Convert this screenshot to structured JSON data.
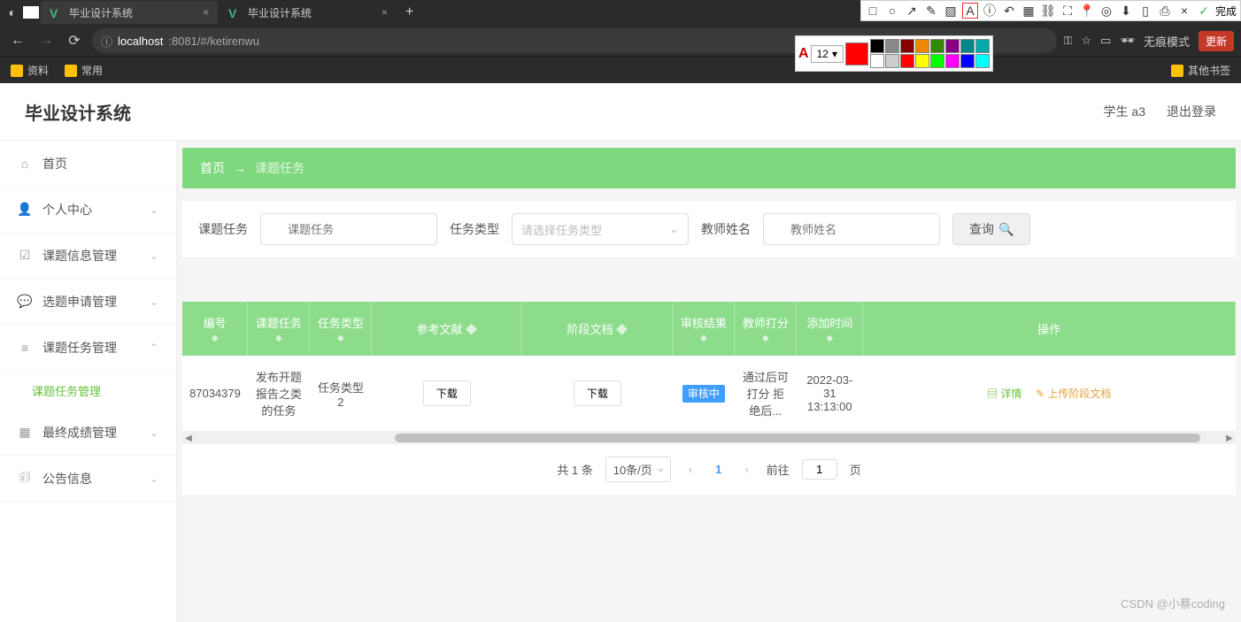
{
  "browser": {
    "tabs": [
      {
        "title": "毕业设计系统",
        "active": true
      },
      {
        "title": "毕业设计系统",
        "active": false
      }
    ],
    "url_host": "localhost",
    "url_path": ":8081/#/ketirenwu",
    "bookmarks": [
      "资料",
      "常用"
    ],
    "bookmark_right": "其他书签",
    "incognito": "无痕模式",
    "update": "更新",
    "done": "完成"
  },
  "annot": {
    "font_size": "12",
    "letter": "A"
  },
  "header": {
    "title": "毕业设计系统",
    "user": "学生 a3",
    "logout": "退出登录"
  },
  "sidebar": {
    "items": [
      {
        "label": "首页",
        "icon": "⌂",
        "expandable": false
      },
      {
        "label": "个人中心",
        "icon": "👤",
        "expandable": true
      },
      {
        "label": "课题信息管理",
        "icon": "☑",
        "expandable": true
      },
      {
        "label": "选题申请管理",
        "icon": "💬",
        "expandable": true
      },
      {
        "label": "课题任务管理",
        "icon": "≡",
        "expandable": true,
        "open": true
      },
      {
        "label": "最终成绩管理",
        "icon": "▦",
        "expandable": true
      },
      {
        "label": "公告信息",
        "icon": "🗊",
        "expandable": true
      }
    ],
    "submenu_active": "课题任务管理"
  },
  "breadcrumb": {
    "home": "首页",
    "arrow": "→",
    "current": "课题任务"
  },
  "search": {
    "label1": "课题任务",
    "ph1": "课题任务",
    "label2": "任务类型",
    "ph2": "请选择任务类型",
    "label3": "教师姓名",
    "ph3": "教师姓名",
    "query": "查询"
  },
  "table": {
    "headers": [
      "编号",
      "课题任务",
      "任务类型",
      "参考文献",
      "阶段文档",
      "审核结果",
      "教师打分",
      "添加时间",
      "操作"
    ],
    "row": {
      "id": "87034379",
      "task": "发布开题报告之类的任务",
      "type": "任务类型2",
      "download": "下载",
      "status": "审核中",
      "score": "通过后可打分 拒绝后...",
      "time": "2022-03-31 13:13:00",
      "detail": "详情",
      "upload": "上传阶段文档"
    }
  },
  "pagination": {
    "total": "共 1 条",
    "perpage": "10条/页",
    "current": "1",
    "goto_pre": "前往",
    "goto_val": "1",
    "goto_suf": "页"
  },
  "watermark": "CSDN @小蔡coding"
}
